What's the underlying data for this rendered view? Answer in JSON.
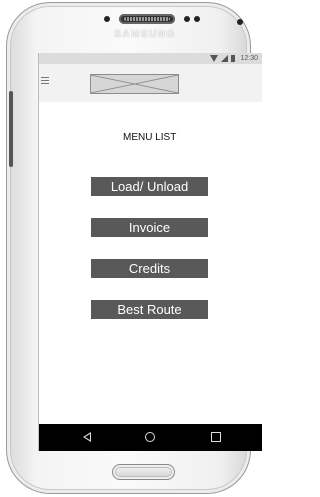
{
  "device": {
    "brand": "SAMSUNG"
  },
  "statusbar": {
    "time": "12:30",
    "icons": [
      "wifi-icon",
      "signal-icon",
      "battery-icon"
    ]
  },
  "appbar": {
    "menu_icon": "hamburger-menu-icon",
    "logo": "image-placeholder"
  },
  "content": {
    "title": "MENU LIST",
    "buttons": [
      {
        "label": "Load/ Unload"
      },
      {
        "label": "Invoice"
      },
      {
        "label": "Credits"
      },
      {
        "label": "Best Route"
      }
    ]
  },
  "navbar": {
    "icons": [
      "back-icon",
      "home-icon",
      "recent-apps-icon"
    ]
  },
  "colors": {
    "button_bg": "#595959",
    "button_text": "#ffffff",
    "appbar_bg": "#f2f2f2",
    "statusbar_bg": "#dcdcdc",
    "navbar_bg": "#000000"
  }
}
